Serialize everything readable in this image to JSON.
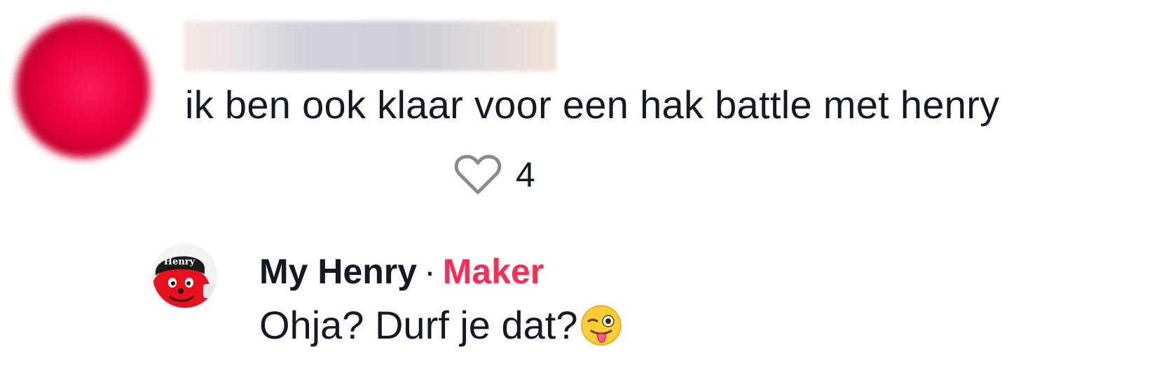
{
  "comment": {
    "author": "",
    "text": "ik ben ook klaar voor een hak battle met henry",
    "likes": "4"
  },
  "reply": {
    "author": "My Henry",
    "separator": "·",
    "badge": "Maker",
    "text": "Ohja? Durf je dat?",
    "avatar_label": "Henry",
    "emoji": "winking-face-with-tongue"
  },
  "colors": {
    "accent": "#fe2c55",
    "text": "#161823",
    "icon": "#8a8b91"
  }
}
